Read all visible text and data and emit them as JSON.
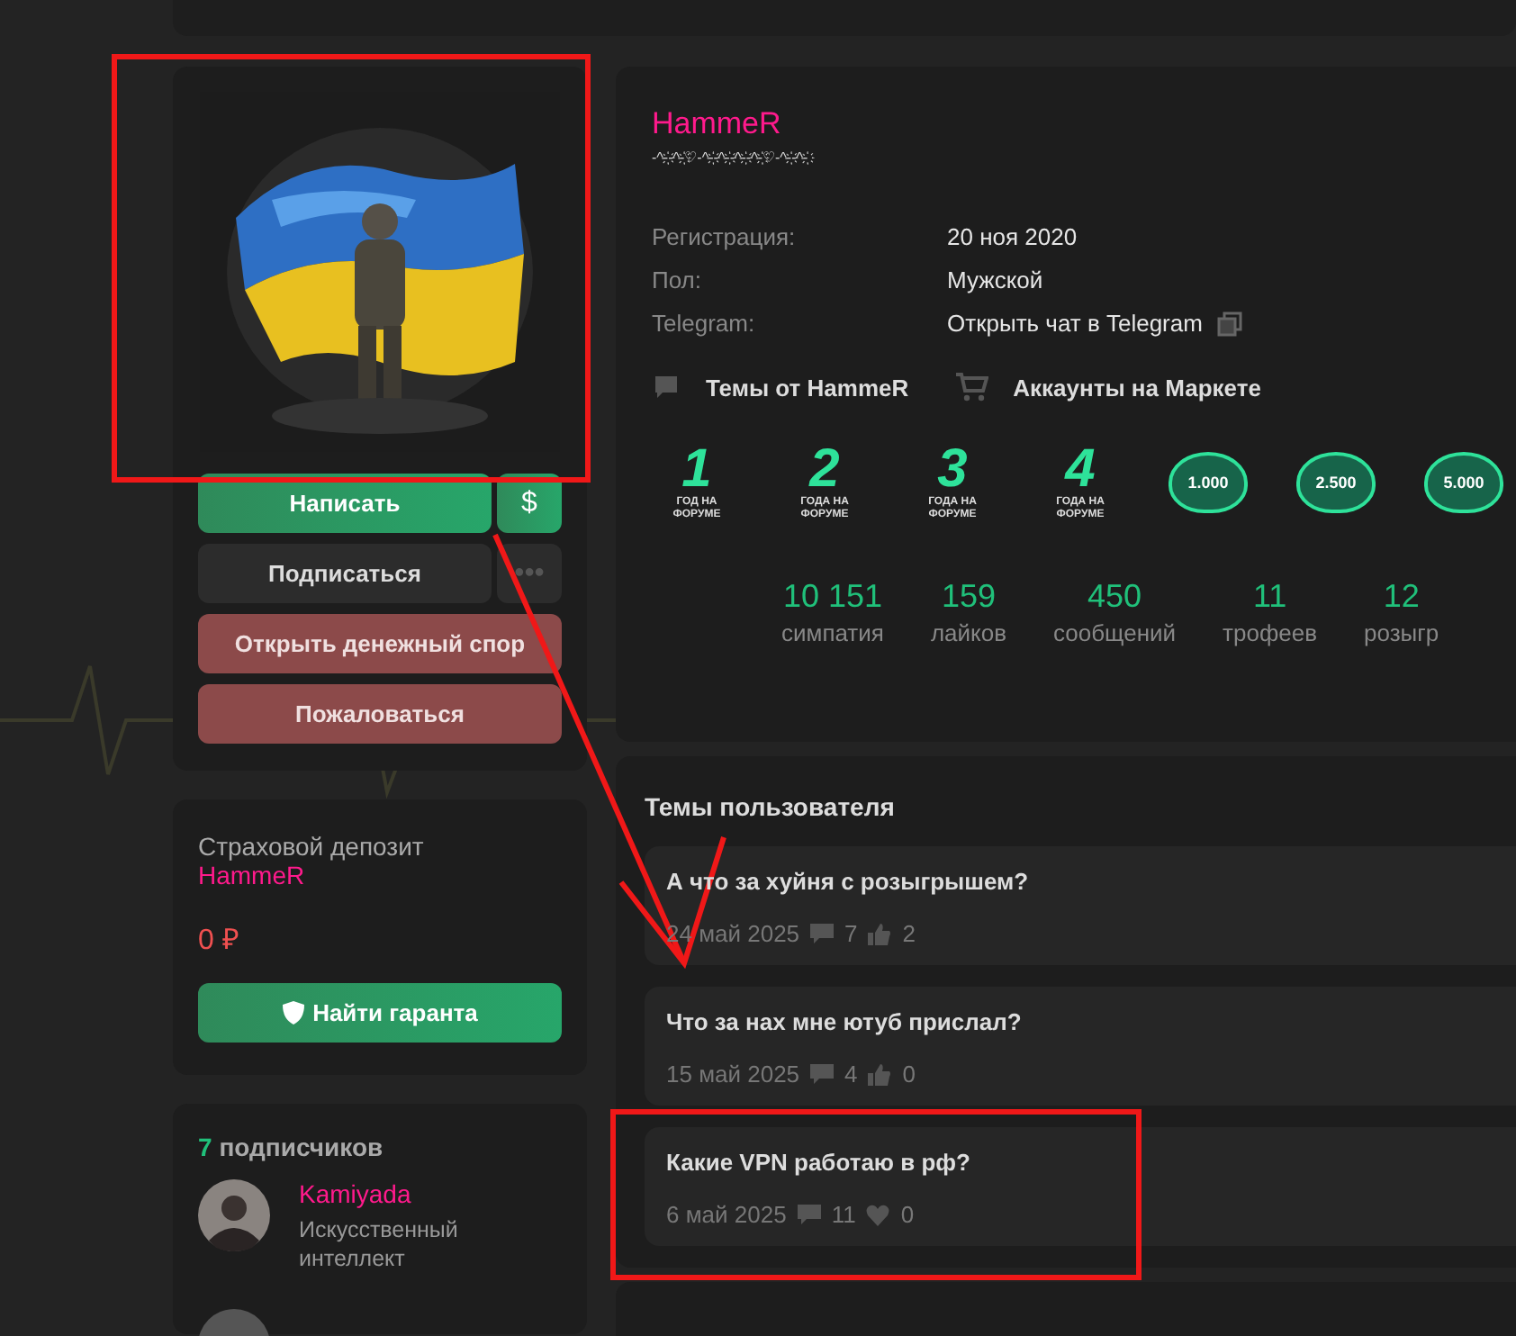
{
  "profile": {
    "username": "HammeR",
    "status_line": "-^-҉-^-҉♡-^-҉-^-҉-^-҉-^-҉♡-^-҉-^-҉",
    "fields": [
      {
        "label": "Регистрация:",
        "value": "20 ноя 2020"
      },
      {
        "label": "Пол:",
        "value": "Мужской"
      },
      {
        "label": "Telegram:",
        "value": "Открыть чат в Telegram",
        "kind": "copyable"
      }
    ],
    "links": [
      {
        "kind": "topics",
        "label": "Темы от HammeR"
      },
      {
        "kind": "market",
        "label": "Аккаунты на Маркете"
      }
    ],
    "badges": [
      {
        "kind": "year",
        "number": "1",
        "caption": "ГОД НА ФОРУМЕ"
      },
      {
        "kind": "year",
        "number": "2",
        "caption": "ГОДА НА ФОРУМЕ"
      },
      {
        "kind": "year",
        "number": "3",
        "caption": "ГОДА НА ФОРУМЕ"
      },
      {
        "kind": "year",
        "number": "4",
        "caption": "ГОДА НА ФОРУМЕ"
      },
      {
        "kind": "heart",
        "number": "1.000"
      },
      {
        "kind": "heart",
        "number": "2.500"
      },
      {
        "kind": "heart",
        "number": "5.000"
      }
    ],
    "stats": [
      {
        "value": "10 151",
        "label": "симпатия"
      },
      {
        "value": "159",
        "label": "лайков"
      },
      {
        "value": "450",
        "label": "сообщений"
      },
      {
        "value": "11",
        "label": "трофеев"
      },
      {
        "value": "12",
        "label": "розыгр"
      }
    ]
  },
  "actions": [
    {
      "kind": "green",
      "label": "Написать",
      "side": "$"
    },
    {
      "kind": "dark",
      "label": "Подписаться",
      "side": "•••"
    },
    {
      "kind": "red",
      "label": "Открыть денежный спор"
    },
    {
      "kind": "red",
      "label": "Пожаловаться"
    }
  ],
  "deposit": {
    "title": "Страховой депозит",
    "username": "HammeR",
    "amount": "0 ₽",
    "button": "Найти гаранта"
  },
  "followers": {
    "count": "7",
    "label": "подписчиков",
    "items": [
      {
        "name": "Kamiyada",
        "title": "Искусственный интеллект"
      }
    ]
  },
  "topics": {
    "title": "Темы пользователя",
    "items": [
      {
        "title": "А что за хуйня с розыгрышем?",
        "date": "24 май 2025",
        "comments": "7",
        "kind": "like",
        "reactions": "2"
      },
      {
        "title": "Что за нах мне ютуб прислал?",
        "date": "15 май 2025",
        "comments": "4",
        "kind": "like",
        "reactions": "0"
      },
      {
        "title": "Какие VPN работаю в рф?",
        "date": "6 май 2025",
        "comments": "11",
        "kind": "heart",
        "reactions": "0"
      }
    ]
  }
}
